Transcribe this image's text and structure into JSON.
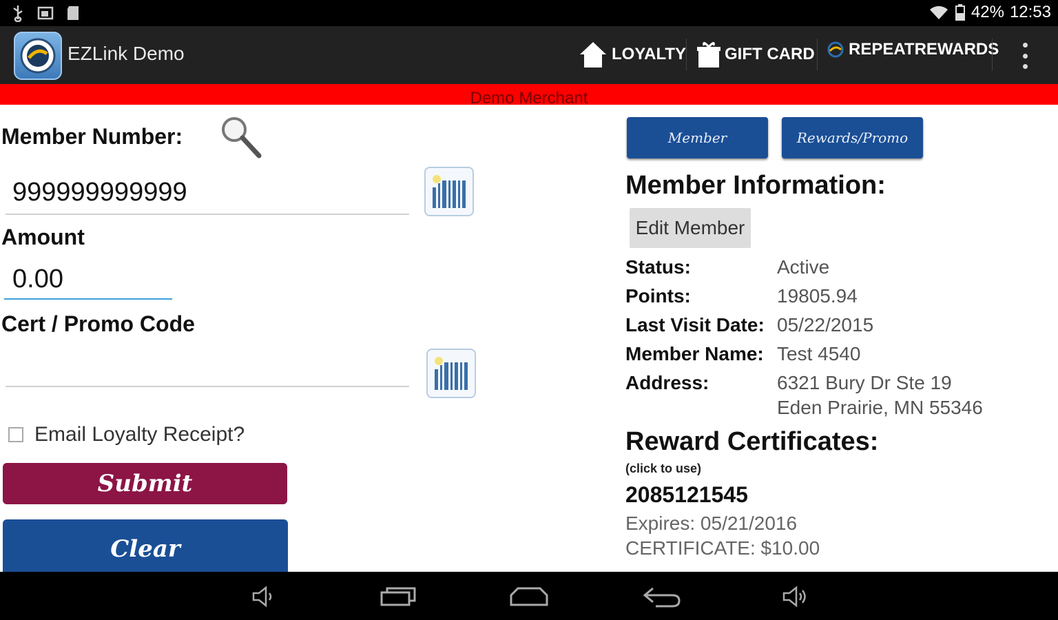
{
  "status_bar": {
    "battery": "42%",
    "time": "12:53",
    "icons": [
      "usb-icon",
      "screenshot-icon",
      "sd-card-icon",
      "wifi-icon",
      "battery-icon"
    ]
  },
  "action_bar": {
    "app_title": "EZLink Demo",
    "nav": [
      {
        "label": "LOYALTY",
        "icon": "home-icon"
      },
      {
        "label": "GIFT CARD",
        "icon": "gift-icon"
      },
      {
        "label": "REPEATREWARDS",
        "icon": "repeat-icon"
      }
    ]
  },
  "merchant": {
    "name": "Demo Merchant",
    "bar_color": "#ff0000"
  },
  "form": {
    "member_number_label": "Member Number:",
    "member_number_value": "999999999999",
    "amount_label": "Amount",
    "amount_value": "0.00",
    "promo_label": "Cert / Promo Code",
    "promo_value": "",
    "email_receipt_label": "Email Loyalty Receipt?",
    "email_receipt_checked": false,
    "submit_label": "Submit",
    "clear_label": "Clear"
  },
  "tabs": {
    "member": "Member",
    "rewards": "Rewards/Promo"
  },
  "member_info": {
    "heading": "Member Information:",
    "edit_label": "Edit Member",
    "fields": [
      {
        "key": "Status:",
        "value": "Active"
      },
      {
        "key": "Points:",
        "value": "19805.94"
      },
      {
        "key": "Last Visit Date:",
        "value": "05/22/2015"
      },
      {
        "key": "Member Name:",
        "value": "Test 4540"
      },
      {
        "key": "Address:",
        "value": "6321 Bury Dr Ste 19",
        "value2": "Eden Prairie, MN  55346"
      }
    ]
  },
  "certificates": {
    "heading": "Reward Certificates:",
    "hint": "(click to use)",
    "items": [
      {
        "number": "2085121545",
        "expires": "Expires:  05/21/2016",
        "amount": "CERTIFICATE:  $10.00"
      }
    ]
  },
  "colors": {
    "submit": "#8c1546",
    "clear": "#1a4f96",
    "tab": "#1a4f96"
  }
}
